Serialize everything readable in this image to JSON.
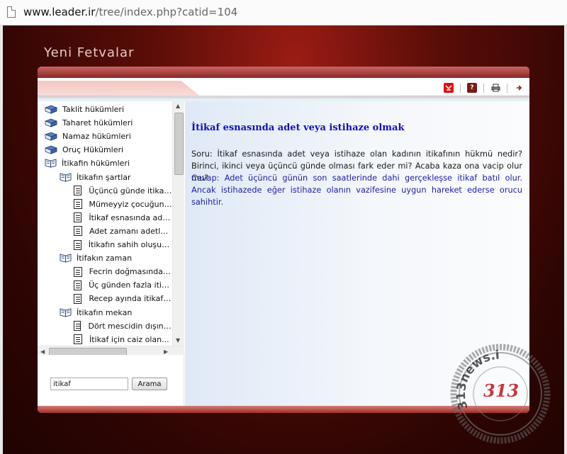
{
  "browser": {
    "url_host": "www.leader.ir",
    "url_path": "/tree/index.php?catid=104"
  },
  "page": {
    "title": "Yeni Fetvalar"
  },
  "toolbar": {
    "icons": [
      "bookmark-icon",
      "help-icon",
      "print-icon",
      "next-icon"
    ]
  },
  "tree": {
    "items": [
      {
        "label": "Taklit hükümleri",
        "icon": "book-closed",
        "level": 0
      },
      {
        "label": "Taharet hükümleri",
        "icon": "book-closed",
        "level": 0
      },
      {
        "label": "Namaz hükümleri",
        "icon": "book-closed",
        "level": 0
      },
      {
        "label": "Oruç Hükümleri",
        "icon": "book-closed",
        "level": 0
      },
      {
        "label": "İtikafin hükümleri",
        "icon": "book-open",
        "level": 0
      },
      {
        "label": "İtikafın şartlar",
        "icon": "book-open",
        "level": 1
      },
      {
        "label": "Üçüncü günde itikafa...",
        "icon": "doc",
        "level": 2
      },
      {
        "label": "Mümeyyiz çocuğun i...",
        "icon": "doc",
        "level": 2
      },
      {
        "label": "İtikaf esnasında adet...",
        "icon": "doc",
        "level": 2
      },
      {
        "label": "Adet zamanı adetle...",
        "icon": "doc",
        "level": 2
      },
      {
        "label": "İtikafın sahih oluşunda...",
        "icon": "doc",
        "level": 2
      },
      {
        "label": "İtifakın zaman",
        "icon": "book-open",
        "level": 1
      },
      {
        "label": "Fecrin doğmasından...",
        "icon": "doc",
        "level": 2
      },
      {
        "label": "Üç günden fazla itikaf...",
        "icon": "doc",
        "level": 2
      },
      {
        "label": "Recep ayında itikafın...",
        "icon": "doc",
        "level": 2
      },
      {
        "label": "İtikafın mekan",
        "icon": "book-open",
        "level": 1
      },
      {
        "label": "Dört mescidin dışındaki...",
        "icon": "doc",
        "level": 2
      },
      {
        "label": "İtikaf için caiz olan...",
        "icon": "doc",
        "level": 2
      }
    ]
  },
  "search": {
    "value": "itikaf",
    "button_label": "Arama"
  },
  "article": {
    "title": "İtikaf esnasında adet veya istihaze olmak",
    "question": "Soru: İtikaf esnasında adet veya istihaze olan kadının itikafının hükmü nedir? Birinci, ikinci veya üçüncü günde olması fark eder mi? Acaba kaza ona vacip olur mu?",
    "answer": "Cevap: Adet üçüncü günün son saatlerinde dahi gerçekleşse itikaf batıl olur. Ancak istihazede eğer istihaze olanın vazifesine uygun hareket ederse orucu sahihtir."
  },
  "watermark": {
    "text": "313news.i",
    "number": "313"
  },
  "colors": {
    "background_dark_red": "#5a0d08",
    "title_blue": "#1111bb",
    "answer_blue": "#2121a5",
    "panel_bar_red": "#9e302a"
  }
}
